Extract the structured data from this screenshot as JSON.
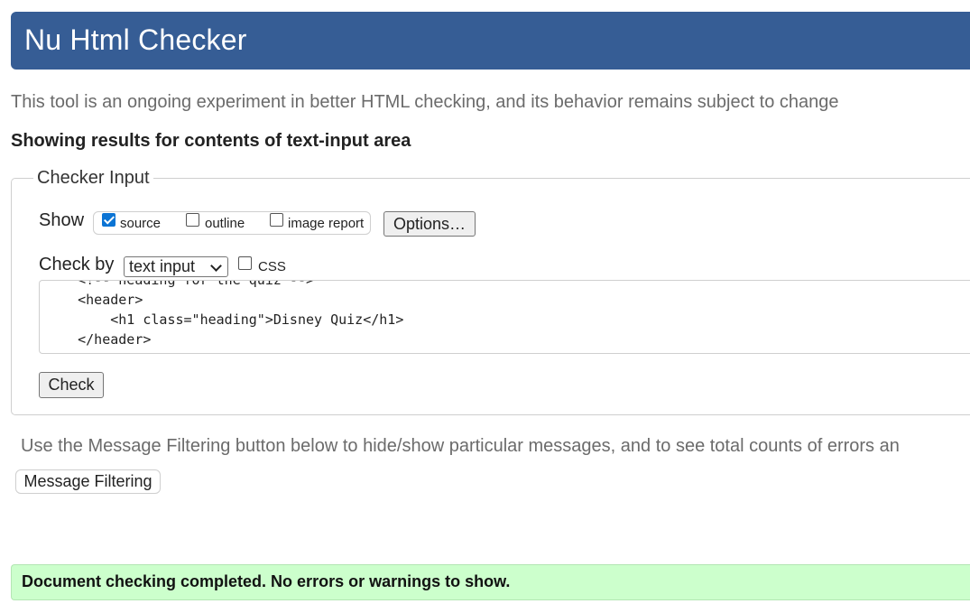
{
  "header": {
    "title": "Nu Html Checker"
  },
  "intro_text": "This tool is an ongoing experiment in better HTML checking, and its behavior remains subject to change",
  "results_heading": "Showing results for contents of text-input area",
  "checker_input": {
    "legend": "Checker Input",
    "show_label": "Show",
    "show_options": [
      {
        "label": "source",
        "checked": true
      },
      {
        "label": "outline",
        "checked": false
      },
      {
        "label": "image report",
        "checked": false
      }
    ],
    "options_button": "Options…",
    "check_by_label": "Check by",
    "check_by_select": "text input",
    "css_checkbox": {
      "label": "CSS",
      "checked": false
    },
    "source_lines": [
      "    <!-- heading for the quiz -->",
      "    <header>",
      "        <h1 class=\"heading\">Disney Quiz</h1>",
      "    </header>"
    ],
    "check_button": "Check"
  },
  "message_filtering": {
    "note": "Use the Message Filtering button below to hide/show particular messages, and to see total counts of errors an",
    "button": "Message Filtering"
  },
  "status": {
    "message": "Document checking completed. No errors or warnings to show.",
    "color": "#ccffcc"
  },
  "colors": {
    "banner": "#365d95",
    "accent": "#0b74d4"
  }
}
